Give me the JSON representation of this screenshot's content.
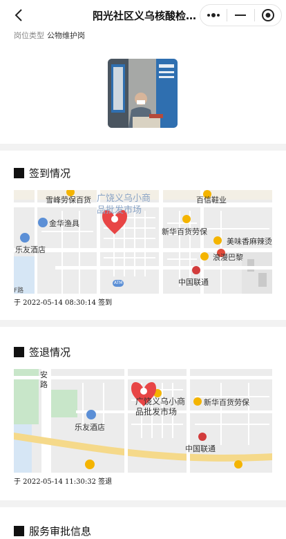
{
  "header": {
    "title": "阳光社区义乌核酸检…"
  },
  "post": {
    "label": "岗位类型",
    "value": "公物维护岗"
  },
  "checkin": {
    "title": "签到情况",
    "caption": "于 2022-05-14 08:30:14 签到",
    "map_labels": {
      "market": "广饶义乌小商品批发市场",
      "market_l1": "广饶义乌小商",
      "market_l2": "品批发市场",
      "xuefeng": "雪峰劳保百货",
      "baixin": "百信鞋业",
      "jinhua": "金华渔具",
      "xinhua": "新华百货劳保",
      "meiwei": "美味香麻辣烫",
      "leyou": "乐友酒店",
      "langman": "浪漫巴黎",
      "unicom": "中国联通",
      "atm": "ATM",
      "edge": "F路"
    }
  },
  "checkout": {
    "title": "签退情况",
    "caption": "于 2022-05-14 11:30:32 签退",
    "map_labels": {
      "an": "安",
      "lu": "路",
      "market_l1": "广饶义乌小商",
      "market_l2": "品批发市场",
      "xinhua": "新华百货劳保",
      "leyou": "乐友酒店",
      "unicom": "中国联通"
    }
  },
  "approval": {
    "title": "服务审批信息"
  },
  "colors": {
    "pin": "#e84545",
    "section_gap": "#f2f2f2",
    "map_road": "#ffffff",
    "map_bg": "#eeeeee",
    "map_green": "#c8e6c9",
    "map_highway": "#f5d98a"
  }
}
